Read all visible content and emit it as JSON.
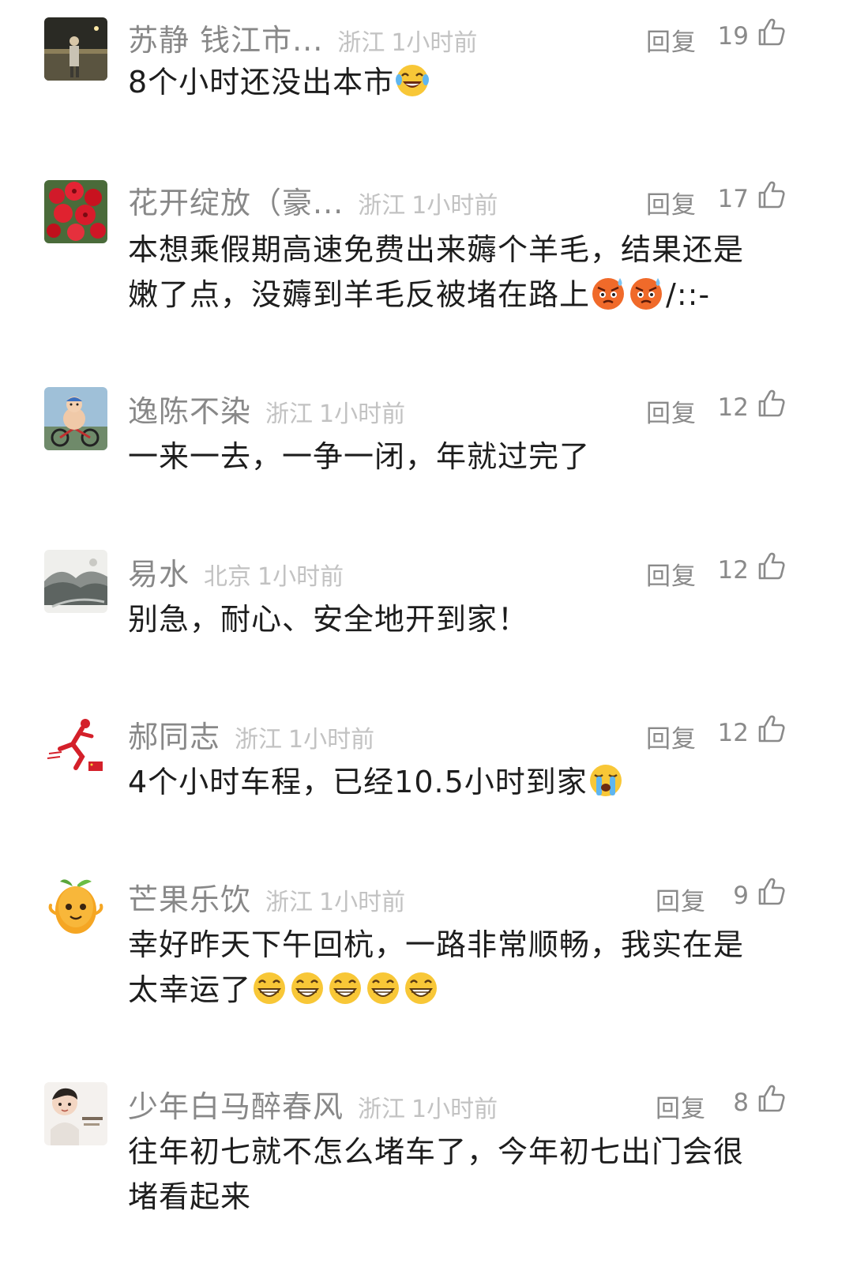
{
  "ui": {
    "reply_label": "回复"
  },
  "comments": [
    {
      "username": "苏静 钱江市...",
      "location": "浙江",
      "time": "1小时前",
      "likes": "19",
      "lines": [
        "8个小时还没出本市"
      ],
      "emojis_after": [
        "laughing-tears-emoji"
      ]
    },
    {
      "username": "花开绽放（豪...",
      "location": "浙江",
      "time": "1小时前",
      "likes": "17",
      "lines": [
        "本想乘假期高速免费出来薅个羊毛，结果还是",
        "嫩了点，没薅到羊毛反被堵在路上"
      ],
      "emojis_after": [
        "angry-sweat-emoji",
        "angry-sweat-emoji"
      ],
      "suffix": "/::-"
    },
    {
      "username": "逸陈不染",
      "location": "浙江",
      "time": "1小时前",
      "likes": "12",
      "lines": [
        "一来一去，一争一闭，年就过完了"
      ]
    },
    {
      "username": "易水",
      "location": "北京",
      "time": "1小时前",
      "likes": "12",
      "lines": [
        "别急，耐心、安全地开到家！"
      ]
    },
    {
      "username": "郝同志",
      "location": "浙江",
      "time": "1小时前",
      "likes": "12",
      "lines": [
        "4个小时车程，已经10.5小时到家"
      ],
      "emojis_after": [
        "crying-emoji"
      ]
    },
    {
      "username": "芒果乐饮",
      "location": "浙江",
      "time": "1小时前",
      "likes": "9",
      "lines": [
        "幸好昨天下午回杭，一路非常顺畅，我实在是",
        "太幸运了"
      ],
      "emojis_after": [
        "grin-emoji",
        "grin-emoji",
        "grin-emoji",
        "grin-emoji",
        "grin-emoji"
      ]
    },
    {
      "username": "少年白马醉春风",
      "location": "浙江",
      "time": "1小时前",
      "likes": "8",
      "lines": [
        "往年初七就不怎么堵车了，今年初七出门会很",
        "堵看起来"
      ]
    }
  ]
}
